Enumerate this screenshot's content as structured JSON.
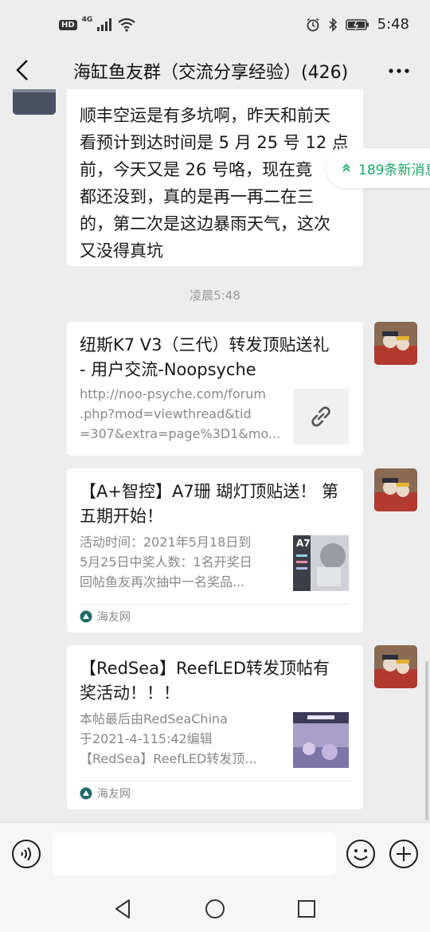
{
  "status_bar": {
    "hd": "HD",
    "network": "4G",
    "time": "5:48"
  },
  "header": {
    "title": "海缸鱼友群（交流分享经验）(426)"
  },
  "new_messages": {
    "label": "189条新消息"
  },
  "messages": {
    "text_message": {
      "lines": [
        "顺丰空运是有多坑啊，昨天和前天",
        "看预计到达时间是 5 月 25 号 12 点",
        "前，今天又是 26 号咯，现在竟",
        "都还没到，真的是再一再二在三",
        "的，第二次是这边暴雨天气，这次",
        "又没得真坑"
      ]
    },
    "timestamp": "凌晨5:48",
    "card1": {
      "title_lines": [
        "纽斯K7 V3（三代）转发顶贴送礼",
        "- 用户交流-Noopsyche"
      ],
      "desc_lines": [
        "http://noo-psyche.com/forum",
        ".php?mod=viewthread&tid",
        "=307&extra=page%3D1&mo..."
      ],
      "thumb_icon": "link-icon"
    },
    "card2": {
      "title_lines": [
        "【A+智控】A7珊 瑚灯顶贴送！ 第",
        "五期开始！"
      ],
      "desc_lines": [
        "活动时间：2021年5月18日到",
        "5月25日中奖人数：1名开奖日",
        "回帖鱼友再次抽中一名奖品..."
      ],
      "thumb_label": "A7",
      "source": "海友网"
    },
    "card3": {
      "title_lines": [
        "【RedSea】ReefLED转发顶帖有",
        "奖活动！！！"
      ],
      "desc_lines": [
        "本帖最后由RedSeaChina",
        "于2021-4-115:42编辑",
        "【RedSea】ReefLED转发顶..."
      ],
      "source": "海友网"
    }
  },
  "colors": {
    "background": "#ededed",
    "bubble": "#ffffff",
    "accent_green": "#19a868"
  }
}
